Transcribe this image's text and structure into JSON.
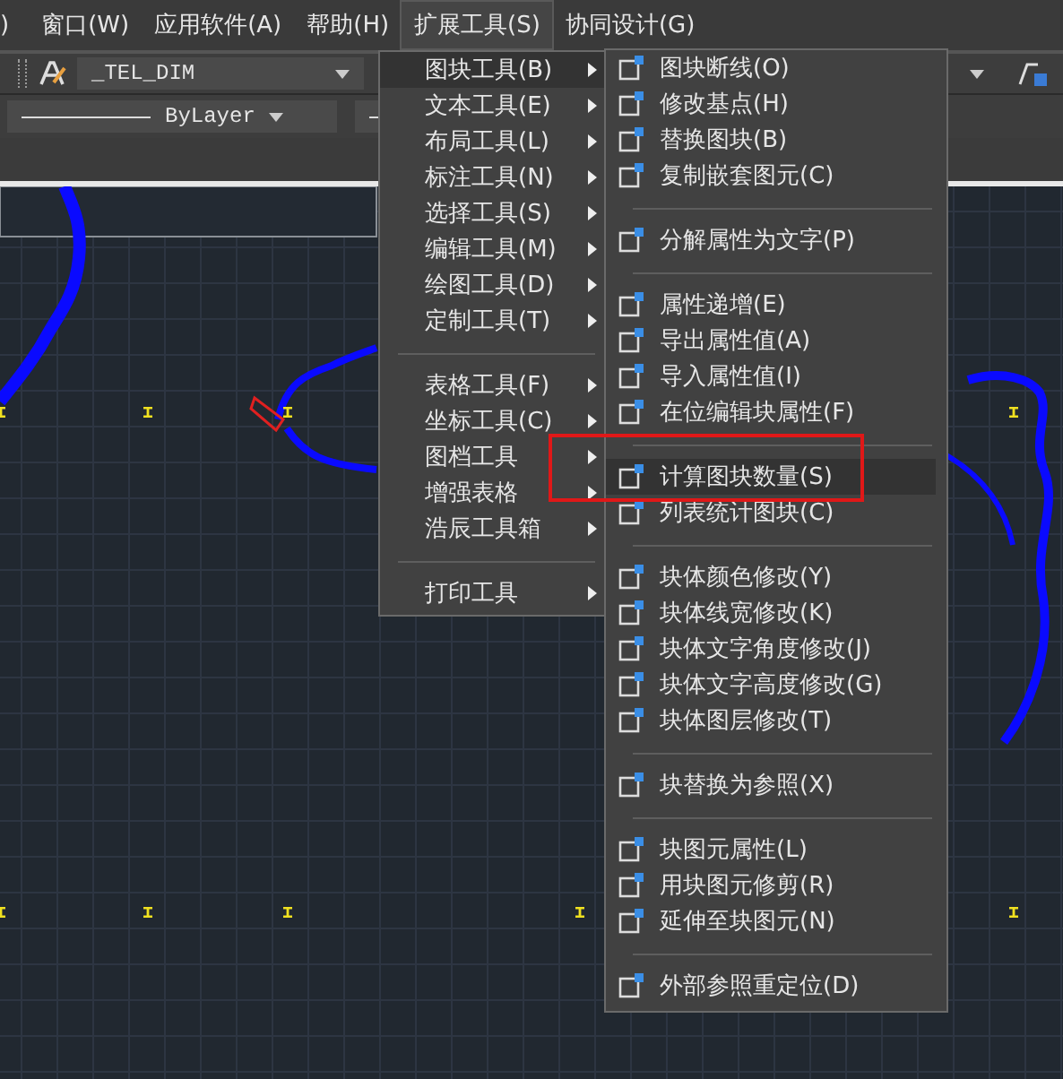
{
  "menu_bar": [
    {
      "label": ")",
      "selected": false
    },
    {
      "label": "窗口(W)",
      "selected": false
    },
    {
      "label": "应用软件(A)",
      "selected": false
    },
    {
      "label": "帮助(H)",
      "selected": false
    },
    {
      "label": "扩展工具(S)",
      "selected": true
    },
    {
      "label": "协同设计(G)",
      "selected": false
    }
  ],
  "toolbar": {
    "text_style": "_TEL_DIM",
    "linetype": "ByLayer"
  },
  "main_menu": [
    {
      "kind": "item",
      "label": "图块工具(B)",
      "selected": true
    },
    {
      "kind": "item",
      "label": "文本工具(E)",
      "selected": false
    },
    {
      "kind": "item",
      "label": "布局工具(L)",
      "selected": false
    },
    {
      "kind": "item",
      "label": "标注工具(N)",
      "selected": false
    },
    {
      "kind": "item",
      "label": "选择工具(S)",
      "selected": false
    },
    {
      "kind": "item",
      "label": "编辑工具(M)",
      "selected": false
    },
    {
      "kind": "item",
      "label": "绘图工具(D)",
      "selected": false
    },
    {
      "kind": "item",
      "label": "定制工具(T)",
      "selected": false
    },
    {
      "kind": "separator"
    },
    {
      "kind": "item",
      "label": "表格工具(F)",
      "selected": false
    },
    {
      "kind": "item",
      "label": "坐标工具(C)",
      "selected": false
    },
    {
      "kind": "item",
      "label": "图档工具",
      "selected": false
    },
    {
      "kind": "item",
      "label": "增强表格",
      "selected": false
    },
    {
      "kind": "item",
      "label": "浩辰工具箱",
      "selected": false
    },
    {
      "kind": "separator"
    },
    {
      "kind": "item",
      "label": "打印工具",
      "selected": false
    }
  ],
  "submenu": [
    {
      "kind": "item",
      "label": "图块断线(O)",
      "selected": false
    },
    {
      "kind": "item",
      "label": "修改基点(H)",
      "selected": false
    },
    {
      "kind": "item",
      "label": "替换图块(B)",
      "selected": false
    },
    {
      "kind": "item",
      "label": "复制嵌套图元(C)",
      "selected": false
    },
    {
      "kind": "separator"
    },
    {
      "kind": "item",
      "label": "分解属性为文字(P)",
      "selected": false
    },
    {
      "kind": "separator"
    },
    {
      "kind": "item",
      "label": "属性递增(E)",
      "selected": false
    },
    {
      "kind": "item",
      "label": "导出属性值(A)",
      "selected": false
    },
    {
      "kind": "item",
      "label": "导入属性值(I)",
      "selected": false
    },
    {
      "kind": "item",
      "label": "在位编辑块属性(F)",
      "selected": false
    },
    {
      "kind": "separator"
    },
    {
      "kind": "item",
      "label": "计算图块数量(S)",
      "selected": true
    },
    {
      "kind": "item",
      "label": "列表统计图块(C)",
      "selected": false
    },
    {
      "kind": "separator"
    },
    {
      "kind": "item",
      "label": "块体颜色修改(Y)",
      "selected": false
    },
    {
      "kind": "item",
      "label": "块体线宽修改(K)",
      "selected": false
    },
    {
      "kind": "item",
      "label": "块体文字角度修改(J)",
      "selected": false
    },
    {
      "kind": "item",
      "label": "块体文字高度修改(G)",
      "selected": false
    },
    {
      "kind": "item",
      "label": "块体图层修改(T)",
      "selected": false
    },
    {
      "kind": "separator"
    },
    {
      "kind": "item",
      "label": "块替换为参照(X)",
      "selected": false
    },
    {
      "kind": "separator"
    },
    {
      "kind": "item",
      "label": "块图元属性(L)",
      "selected": false
    },
    {
      "kind": "item",
      "label": "用块图元修剪(R)",
      "selected": false
    },
    {
      "kind": "item",
      "label": "延伸至块图元(N)",
      "selected": false
    },
    {
      "kind": "separator"
    },
    {
      "kind": "item",
      "label": "外部参照重定位(D)",
      "selected": false
    }
  ]
}
